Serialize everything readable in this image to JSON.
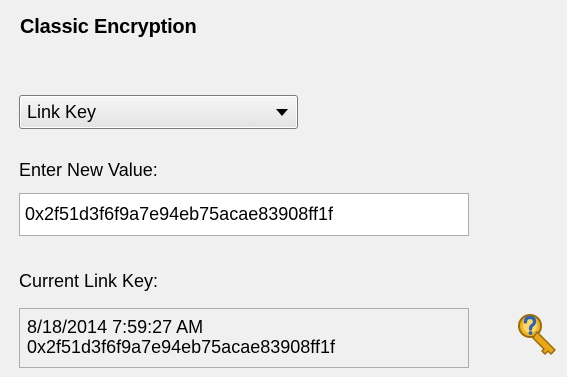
{
  "section_title": "Classic Encryption",
  "key_type_select": {
    "selected": "Link Key"
  },
  "new_value": {
    "label": "Enter New Value:",
    "value": "0x2f51d3f6f9a7e94eb75acae83908ff1f"
  },
  "current": {
    "label": "Current Link Key:",
    "timestamp": "8/18/2014 7:59:27 AM",
    "value": "0x2f51d3f6f9a7e94eb75acae83908ff1f"
  },
  "icons": {
    "apply_key": "key-with-question-mark-icon"
  },
  "colors": {
    "panel_background": "#f0f0f0",
    "key_gold": "#e8a818",
    "question_blue": "#2a63b8"
  }
}
